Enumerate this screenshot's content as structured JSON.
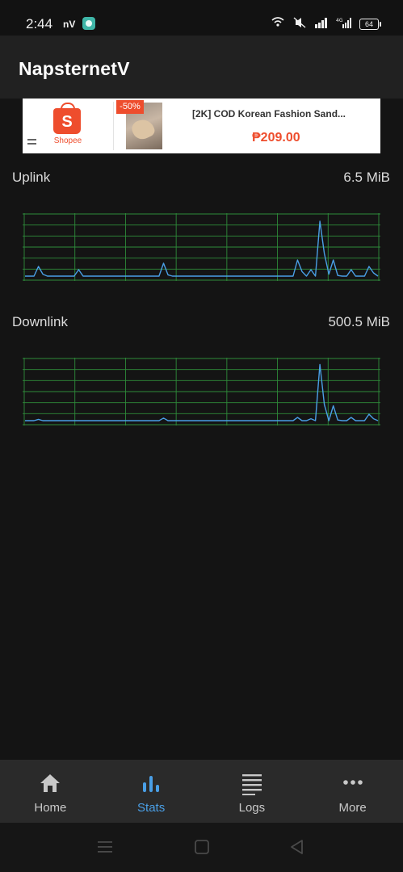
{
  "status_bar": {
    "time": "2:44",
    "app_badge": "nV",
    "battery": "64",
    "network_label": "4G"
  },
  "app_bar": {
    "title": "NapsternetV"
  },
  "ad": {
    "brand": "Shopee",
    "brand_mark": "S",
    "discount": "-50%",
    "product_title": "[2K] COD Korean Fashion Sand...",
    "price": "₱209.00",
    "colors": {
      "brand": "#ee4d2d"
    }
  },
  "stats": {
    "uplink": {
      "label": "Uplink",
      "value": "6.5 MiB"
    },
    "downlink": {
      "label": "Downlink",
      "value": "500.5 MiB"
    }
  },
  "chart_data": [
    {
      "type": "line",
      "title": "Uplink",
      "grid": true,
      "series": [
        {
          "values": [
            0.05,
            0.05,
            0.05,
            0.2,
            0.08,
            0.05,
            0.05,
            0.05,
            0.05,
            0.05,
            0.05,
            0.05,
            0.15,
            0.05,
            0.05,
            0.05,
            0.05,
            0.05,
            0.05,
            0.05,
            0.05,
            0.05,
            0.05,
            0.05,
            0.05,
            0.05,
            0.05,
            0.05,
            0.05,
            0.05,
            0.05,
            0.25,
            0.07,
            0.05,
            0.05,
            0.05,
            0.05,
            0.05,
            0.05,
            0.05,
            0.05,
            0.05,
            0.05,
            0.05,
            0.05,
            0.05,
            0.05,
            0.05,
            0.05,
            0.05,
            0.05,
            0.05,
            0.05,
            0.05,
            0.05,
            0.05,
            0.05,
            0.05,
            0.05,
            0.05,
            0.05,
            0.3,
            0.12,
            0.05,
            0.15,
            0.05,
            0.9,
            0.4,
            0.08,
            0.3,
            0.06,
            0.05,
            0.05,
            0.15,
            0.05,
            0.05,
            0.05,
            0.2,
            0.1,
            0.05
          ]
        }
      ],
      "colors": {
        "line": "#4a9fe6",
        "grid": "#2e8b3a"
      }
    },
    {
      "type": "line",
      "title": "Downlink",
      "grid": true,
      "series": [
        {
          "values": [
            0.05,
            0.05,
            0.05,
            0.07,
            0.05,
            0.05,
            0.05,
            0.05,
            0.05,
            0.05,
            0.05,
            0.05,
            0.05,
            0.05,
            0.05,
            0.05,
            0.05,
            0.05,
            0.05,
            0.05,
            0.05,
            0.05,
            0.05,
            0.05,
            0.05,
            0.05,
            0.05,
            0.05,
            0.05,
            0.05,
            0.05,
            0.09,
            0.05,
            0.05,
            0.05,
            0.05,
            0.05,
            0.05,
            0.05,
            0.05,
            0.05,
            0.05,
            0.05,
            0.05,
            0.05,
            0.05,
            0.05,
            0.05,
            0.05,
            0.05,
            0.05,
            0.05,
            0.05,
            0.05,
            0.05,
            0.05,
            0.05,
            0.05,
            0.05,
            0.05,
            0.05,
            0.1,
            0.05,
            0.05,
            0.08,
            0.05,
            0.92,
            0.3,
            0.05,
            0.28,
            0.06,
            0.05,
            0.05,
            0.1,
            0.05,
            0.05,
            0.05,
            0.15,
            0.08,
            0.05
          ]
        }
      ],
      "colors": {
        "line": "#4a9fe6",
        "grid": "#2e8b3a"
      }
    }
  ],
  "bottom_nav": {
    "items": [
      {
        "label": "Home",
        "icon": "home-icon"
      },
      {
        "label": "Stats",
        "icon": "bar-chart-icon",
        "active": true
      },
      {
        "label": "Logs",
        "icon": "list-icon"
      },
      {
        "label": "More",
        "icon": "more-dots-icon"
      }
    ],
    "colors": {
      "active": "#4a9fe6",
      "inactive": "#c8c8c8"
    }
  },
  "system_nav": {
    "icons": [
      "menu-icon",
      "home-square-icon",
      "back-icon"
    ]
  }
}
